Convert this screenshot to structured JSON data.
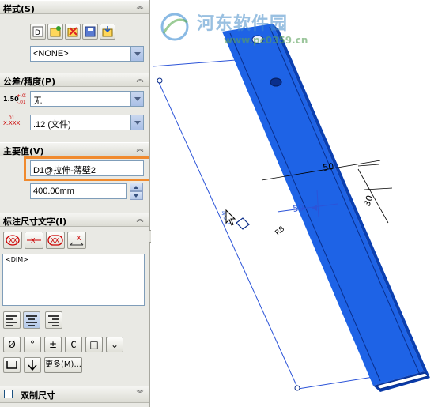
{
  "watermark": {
    "title": "河东软件园",
    "url": "www.pc0359.cn"
  },
  "sections": {
    "style": {
      "title": "样式(S)",
      "collapse_icon": "double-chevron-up-icon",
      "style_value": "<NONE>"
    },
    "tolerance": {
      "title": "公差/精度(P)",
      "tolerance_icon_text": "1.50±.01",
      "tolerance_value": "无",
      "precision_value": ".12 (文件)"
    },
    "primary_value": {
      "title": "主要值(V)",
      "dimension_name": "D1@拉伸-薄壁2",
      "dimension_value": "400.00mm"
    },
    "dimension_text": {
      "title": "标注尺寸文字(I)",
      "text_content": "<DIM>",
      "symbols": [
        "Ø",
        "°",
        "±",
        "₵",
        "□",
        "⌄"
      ],
      "more_label": "更多(M)..."
    },
    "dual_dimension": {
      "title": "双制尺寸",
      "checked": false
    }
  },
  "viewport": {
    "dim_labels": {
      "width_top": "50",
      "height_side": "30",
      "center_width": "50",
      "small_label": "R8",
      "long_dim": "400"
    },
    "colors": {
      "part_blue": "#1e63e6",
      "part_dark": "#0b3fb0",
      "dim_line": "#2c54d8",
      "highlight": "#f08a2e"
    }
  }
}
